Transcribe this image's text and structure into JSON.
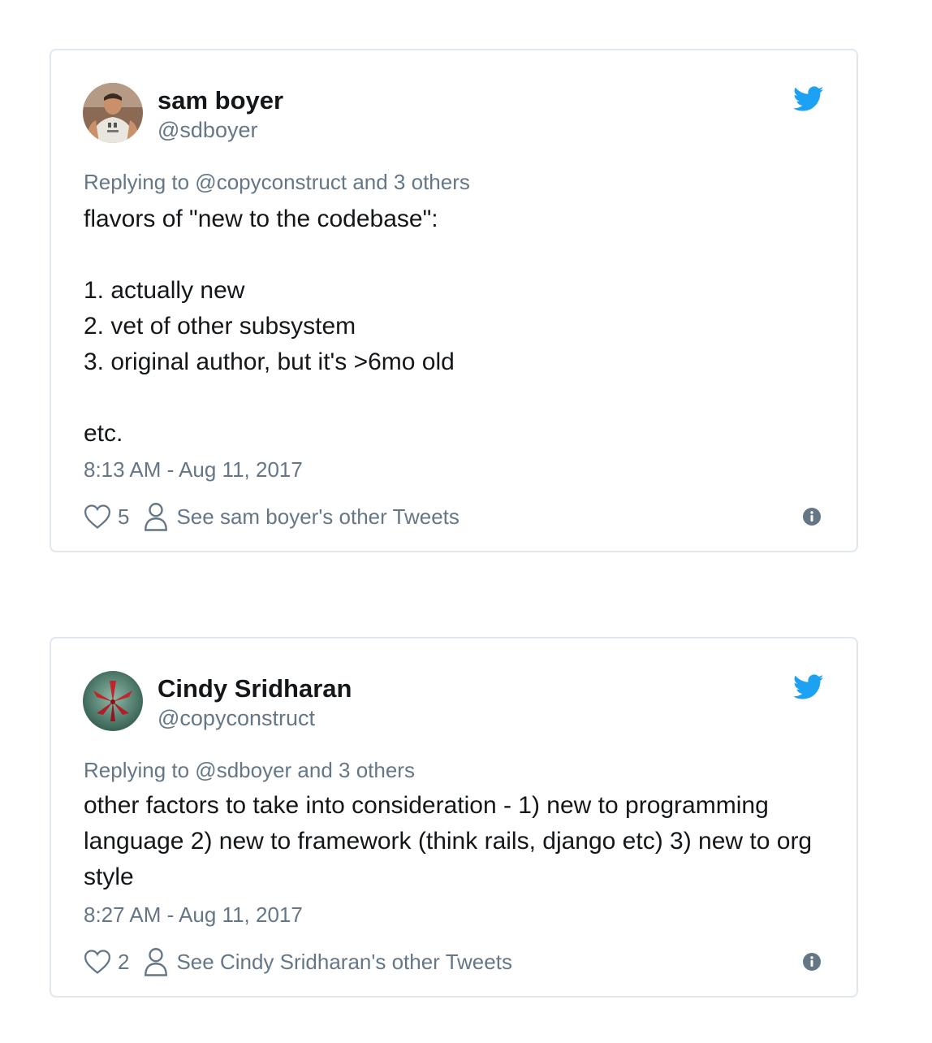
{
  "tweets": [
    {
      "author_name": "sam boyer",
      "author_handle": "@sdboyer",
      "avatar": "photo-man-in-tshirt",
      "replying_to": "Replying to @copyconstruct and 3 others",
      "text": "flavors of \"new to the codebase\":\n\n1. actually new\n2. vet of other subsystem\n3. original author, but it's >6mo old\n\netc.",
      "timestamp": "8:13 AM - Aug 11, 2017",
      "likes": "5",
      "other_tweets_label": "See sam boyer's other Tweets"
    },
    {
      "author_name": "Cindy Sridharan",
      "author_handle": "@copyconstruct",
      "avatar": "photo-red-leaf",
      "replying_to": "Replying to @sdboyer and 3 others",
      "text": "other factors to take into consideration - 1) new to programming language 2) new to framework (think rails, django etc) 3) new to org style",
      "timestamp": "8:27 AM - Aug 11, 2017",
      "likes": "2",
      "other_tweets_label": "See Cindy Sridharan's other Tweets"
    }
  ],
  "icons": {
    "brand": "twitter-bird-icon",
    "like": "heart-icon",
    "profile": "person-icon",
    "info": "info-icon"
  },
  "colors": {
    "brand_blue": "#1da1f2",
    "secondary_text": "#657786",
    "primary_text": "#14171a",
    "border": "#e1e8ed"
  }
}
